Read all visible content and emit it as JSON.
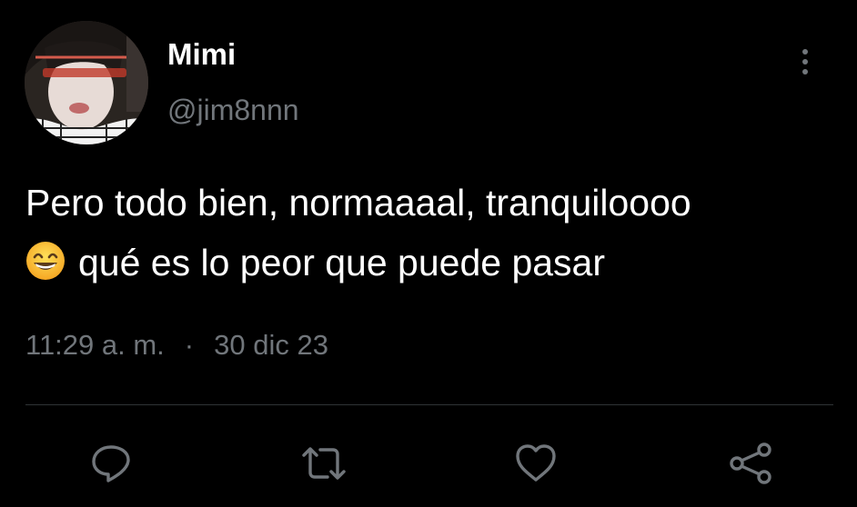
{
  "author": {
    "display_name": "Mimi",
    "handle": "@jim8nnn"
  },
  "tweet": {
    "line1": "Pero todo bien, normaaaal, tranquiloooo",
    "line2": "qué es lo peor que puede pasar",
    "emoji": "grinning-face-with-smiling-eyes"
  },
  "meta": {
    "time": "11:29 a. m.",
    "separator": "·",
    "date": "30 dic 23"
  },
  "actions": [
    "reply-icon",
    "retweet-icon",
    "like-icon",
    "share-icon"
  ],
  "colors": {
    "background": "#000000",
    "text": "#ffffff",
    "secondary": "#71767b",
    "divider": "#2f3336"
  }
}
